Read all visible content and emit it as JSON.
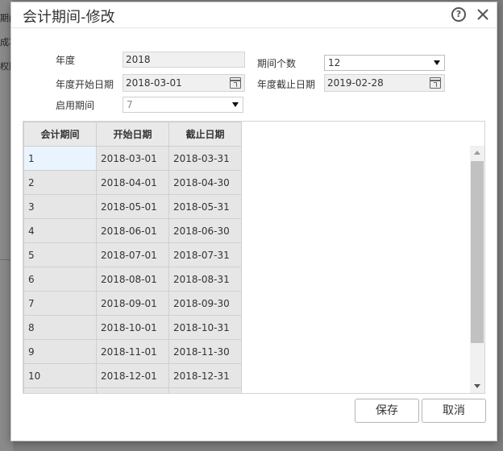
{
  "background": {
    "lines": [
      "期间",
      "成功",
      "权限"
    ]
  },
  "dialog": {
    "title": "会计期间-修改",
    "help_icon": "?",
    "close_icon": "close-icon"
  },
  "form": {
    "year_label": "年度",
    "year_value": "2018",
    "period_count_label": "期间个数",
    "period_count_value": "12",
    "year_start_label": "年度开始日期",
    "year_start_value": "2018-03-01",
    "year_end_label": "年度截止日期",
    "year_end_value": "2019-02-28",
    "enable_period_label": "启用期间",
    "enable_period_value": "7"
  },
  "grid": {
    "headers": [
      "会计期间",
      "开始日期",
      "截止日期"
    ],
    "rows": [
      [
        "1",
        "2018-03-01",
        "2018-03-31"
      ],
      [
        "2",
        "2018-04-01",
        "2018-04-30"
      ],
      [
        "3",
        "2018-05-01",
        "2018-05-31"
      ],
      [
        "4",
        "2018-06-01",
        "2018-06-30"
      ],
      [
        "5",
        "2018-07-01",
        "2018-07-31"
      ],
      [
        "6",
        "2018-08-01",
        "2018-08-31"
      ],
      [
        "7",
        "2018-09-01",
        "2018-09-30"
      ],
      [
        "8",
        "2018-10-01",
        "2018-10-31"
      ],
      [
        "9",
        "2018-11-01",
        "2018-11-30"
      ],
      [
        "10",
        "2018-12-01",
        "2018-12-31"
      ]
    ]
  },
  "buttons": {
    "save_label": "保存",
    "cancel_label": "取消"
  },
  "colors": {
    "selected_row": "#eaf4fe",
    "cell_background": "#e6e6e6"
  }
}
